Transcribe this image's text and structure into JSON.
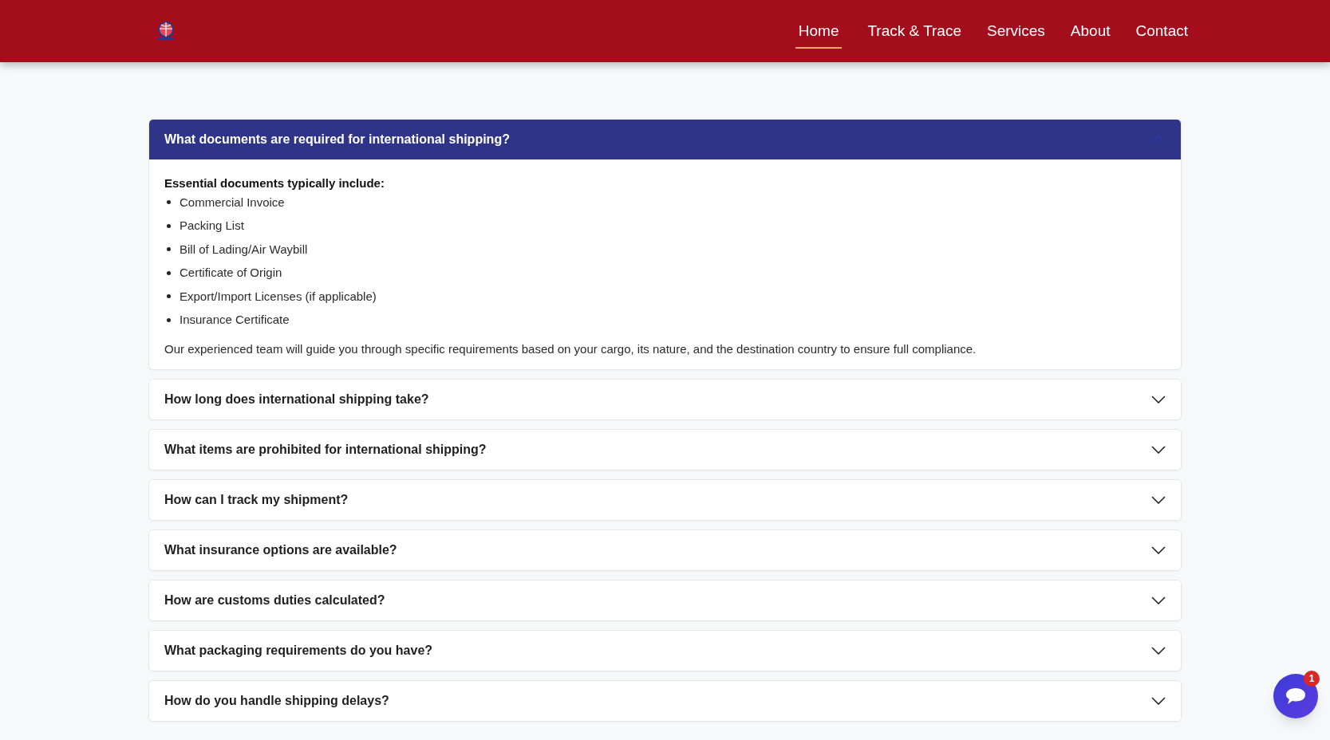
{
  "nav": [
    {
      "label": "Home",
      "selected": true
    },
    {
      "label": "Track & Trace",
      "selected": false
    },
    {
      "label": "Services",
      "selected": false
    },
    {
      "label": "About",
      "selected": false
    },
    {
      "label": "Contact",
      "selected": false
    }
  ],
  "faqs": [
    {
      "question": "What documents are required for international shipping?",
      "expanded": true,
      "answer": {
        "intro": "Essential documents typically include:",
        "items": [
          "Commercial Invoice",
          "Packing List",
          "Bill of Lading/Air Waybill",
          "Certificate of Origin",
          "Export/Import Licenses (if applicable)",
          "Insurance Certificate"
        ],
        "outro": "Our experienced team will guide you through specific requirements based on your cargo, its nature, and the destination country to ensure full compliance."
      }
    },
    {
      "question": "How long does international shipping take?",
      "expanded": false
    },
    {
      "question": "What items are prohibited for international shipping?",
      "expanded": false
    },
    {
      "question": "How can I track my shipment?",
      "expanded": false
    },
    {
      "question": "What insurance options are available?",
      "expanded": false
    },
    {
      "question": "How are customs duties calculated?",
      "expanded": false
    },
    {
      "question": "What packaging requirements do you have?",
      "expanded": false
    },
    {
      "question": "How do you handle shipping delays?",
      "expanded": false
    }
  ],
  "chat": {
    "badge": "1"
  }
}
